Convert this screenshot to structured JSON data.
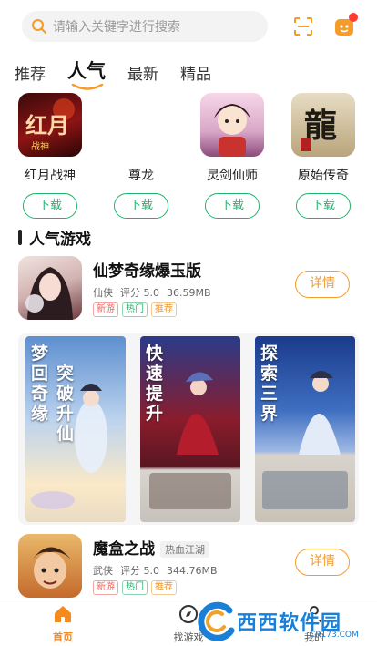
{
  "search": {
    "placeholder": "请输入关键字进行搜索"
  },
  "tabs": [
    {
      "label": "推荐"
    },
    {
      "label": "人气"
    },
    {
      "label": "最新"
    },
    {
      "label": "精品"
    }
  ],
  "top_games": [
    {
      "name": "红月战神",
      "download": "下载"
    },
    {
      "name": "尊龙",
      "download": "下载"
    },
    {
      "name": "灵剑仙师",
      "download": "下载"
    },
    {
      "name": "原始传奇",
      "download": "下载"
    }
  ],
  "section": {
    "title": "人气游戏"
  },
  "games": [
    {
      "title": "仙梦奇缘爆玉版",
      "title_tag": "",
      "genre": "仙侠",
      "rating": "评分 5.0",
      "size": "36.59MB",
      "tags": [
        "新游",
        "热门",
        "推荐"
      ],
      "detail": "详情"
    },
    {
      "title": "魔盒之战",
      "title_tag": "热血江湖",
      "genre": "武侠",
      "rating": "评分 5.0",
      "size": "344.76MB",
      "tags": [
        "新游",
        "热门",
        "推荐"
      ],
      "detail": "详情"
    }
  ],
  "screenshots": [
    {
      "caption_a": "梦回奇缘",
      "caption_b": "突破升仙"
    },
    {
      "caption_a": "快速提升",
      "caption_b": ""
    },
    {
      "caption_a": "探索三界",
      "caption_b": ""
    }
  ],
  "bottom_nav": [
    {
      "label": "首页",
      "active": true
    },
    {
      "label": "找游戏",
      "active": false
    },
    {
      "label": "我的",
      "active": false
    }
  ],
  "watermark": {
    "text": "西西软件园",
    "sub": "CR173.COM"
  },
  "colors": {
    "accent": "#f59b2a",
    "green": "#1fb36b",
    "tag_red": "#f2625b"
  }
}
